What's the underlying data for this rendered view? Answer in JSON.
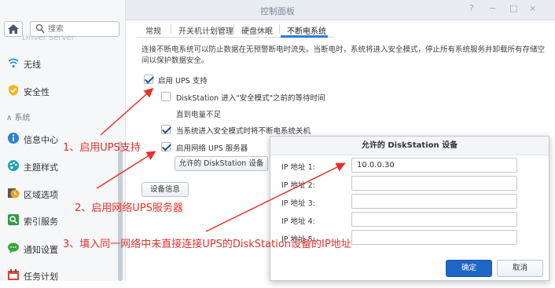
{
  "window": {
    "title": "控制面板",
    "controls": [
      "?",
      "−",
      "□",
      "×"
    ]
  },
  "sidebar": {
    "search_placeholder": "搜索",
    "clipped_item": "Driver Server",
    "items": [
      {
        "label": "无线",
        "icon": "wifi-icon"
      },
      {
        "label": "安全性",
        "icon": "shield-icon"
      },
      {
        "label": "信息中心",
        "icon": "info-icon"
      },
      {
        "label": "主题样式",
        "icon": "palette-icon"
      },
      {
        "label": "区域选项",
        "icon": "clock-icon"
      },
      {
        "label": "索引服务",
        "icon": "index-search-icon"
      },
      {
        "label": "通知设置",
        "icon": "chat-bubble-icon"
      },
      {
        "label": "任务计划",
        "icon": "calendar-icon"
      }
    ],
    "section_label": "系统"
  },
  "tabs": [
    "常规",
    "开关机计划管理",
    "硬盘休眠",
    "不断电系统"
  ],
  "active_tab": "不断电系统",
  "description": "连接不断电系统可以防止数据在无预警断电时流失。当断电时，系统将进入安全模式，停止所有系统服务并卸载所有存储空间以保护数据安全。",
  "options": {
    "enable_ups": {
      "label": "启用 UPS 支持",
      "checked": true
    },
    "wait_time": {
      "label": "DiskStation 进入\"安全模式\"之前的等待时间",
      "checked": false
    },
    "until_low": "直到电量不足",
    "shutdown_ups": {
      "label": "当系统进入安全模式时将不断电系统关机",
      "checked": true
    },
    "network_server": {
      "label": "启用网络 UPS 服务器",
      "checked": true
    }
  },
  "buttons": {
    "allowed_devices": "允许的 DiskStation 设备",
    "device_info": "设备信息"
  },
  "dialog": {
    "title": "允许的 DiskStation 设备",
    "fields": [
      {
        "label": "IP 地址 1:",
        "value": "10.0.0.30"
      },
      {
        "label": "IP 地址 2:",
        "value": ""
      },
      {
        "label": "IP 地址 3:",
        "value": ""
      },
      {
        "label": "IP 地址 4:",
        "value": ""
      },
      {
        "label": "IP 地址 5:",
        "value": ""
      }
    ],
    "ok": "确定",
    "cancel": "取消"
  },
  "annotations": [
    "1、启用UPS支持",
    "2、启用网络UPS服务器",
    "3、填入同一网络中未直接连接UPS的DiskStation设备的IP地址"
  ],
  "colors": {
    "annotation": "#e8312a",
    "primary_button": "#1f67c6",
    "tab_accent": "#2d7dd2"
  }
}
